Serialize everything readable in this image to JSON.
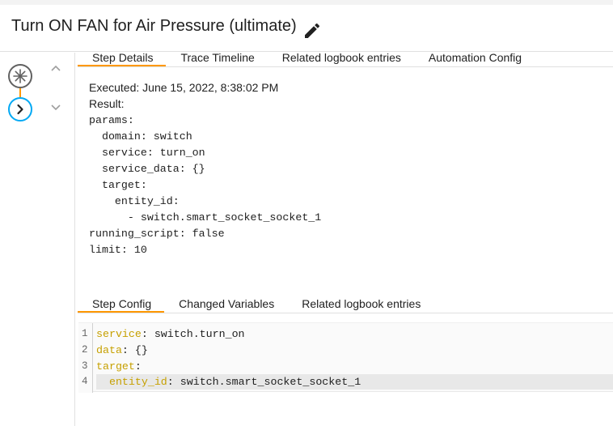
{
  "header": {
    "title": "Turn ON FAN for Air Pressure (ultimate)",
    "edit_icon": "pencil-icon"
  },
  "timeline": {
    "trigger_icon": "asterisk-icon",
    "action_icon": "chevron-right-icon"
  },
  "top_tabs": [
    {
      "label": "Step Details",
      "active": true
    },
    {
      "label": "Trace Timeline",
      "active": false
    },
    {
      "label": "Related logbook entries",
      "active": false
    },
    {
      "label": "Automation Config",
      "active": false
    }
  ],
  "details": {
    "executed": "Executed: June 15, 2022, 8:38:02 PM",
    "result": "Result:",
    "yaml_lines": [
      "params:",
      "  domain: switch",
      "  service: turn_on",
      "  service_data: {}",
      "  target:",
      "    entity_id:",
      "      - switch.smart_socket_socket_1",
      "running_script: false",
      "limit: 10"
    ]
  },
  "bottom_tabs": [
    {
      "label": "Step Config",
      "active": true
    },
    {
      "label": "Changed Variables",
      "active": false
    },
    {
      "label": "Related logbook entries",
      "active": false
    }
  ],
  "editor": {
    "lines": [
      {
        "num": "1",
        "indent": "",
        "key": "service",
        "value": " switch.turn_on"
      },
      {
        "num": "2",
        "indent": "",
        "key": "data",
        "value": " {}"
      },
      {
        "num": "3",
        "indent": "",
        "key": "target",
        "value": ""
      },
      {
        "num": "4",
        "indent": "  ",
        "key": "entity_id",
        "value": " switch.smart_socket_socket_1"
      }
    ],
    "key_color": "#c6a000"
  }
}
